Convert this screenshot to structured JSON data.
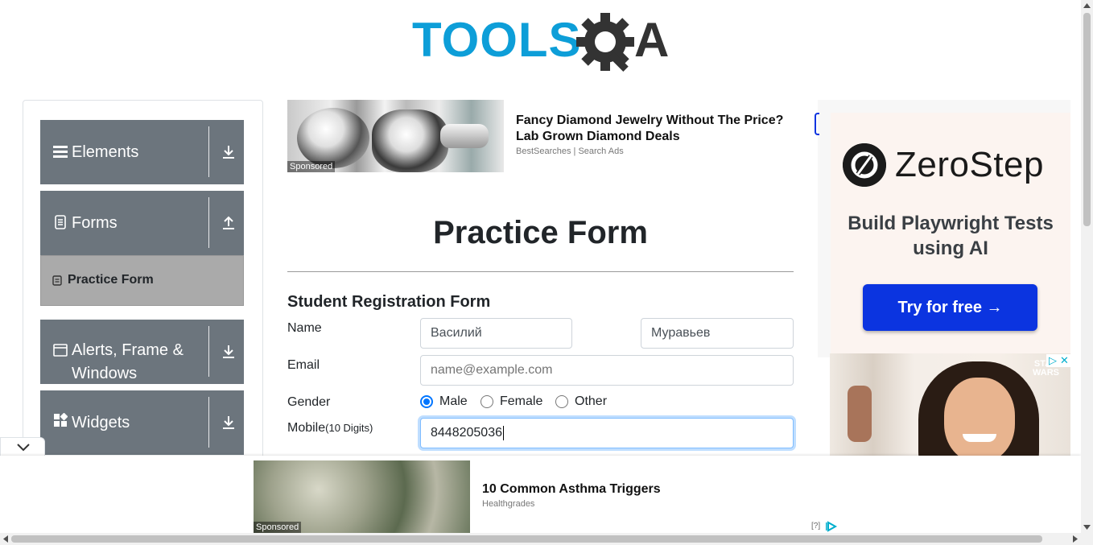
{
  "header": {
    "logo_text": "TOOLSQA"
  },
  "sidebar": {
    "groups": [
      {
        "label": "Elements"
      },
      {
        "label": "Forms"
      },
      {
        "label": "Alerts, Frame &"
      },
      {
        "label": "Windows"
      },
      {
        "label": "Widgets"
      }
    ],
    "active_item": "Practice Form"
  },
  "ad_top": {
    "headline": "Fancy Diamond Jewelry Without The Price? Lab Grown Diamond Deals",
    "source": "BestSearches | Search Ads",
    "sponsored": "Sponsored"
  },
  "main": {
    "page_title": "Practice Form",
    "form_title": "Student Registration Form",
    "name_label": "Name",
    "first_name": "Василий",
    "last_name": "Муравьев",
    "email_label": "Email",
    "email_placeholder": "name@example.com",
    "gender_label": "Gender",
    "gender_options": [
      {
        "label": "Male",
        "checked": true
      },
      {
        "label": "Female",
        "checked": false
      },
      {
        "label": "Other",
        "checked": false
      }
    ],
    "mobile_label": "Mobile",
    "mobile_hint": "(10 Digits)",
    "mobile_value": "8448205036"
  },
  "ad_right": {
    "brand": "ZeroStep",
    "tagline": "Build Playwright Tests using AI",
    "cta": "Try for free →",
    "star_wars": "STAR WARS",
    "close_info": "▷",
    "close_x": "✕"
  },
  "ad_bottom": {
    "headline": "10 Common Asthma Triggers",
    "source": "Healthgrades",
    "sponsored": "Sponsored",
    "choices": "[?]"
  },
  "colors": {
    "sidebar_group": "#6c757d",
    "sidebar_active": "#aaaaaa",
    "accent": "#0075ff",
    "zerostep_button": "#0b34e0",
    "logo_blue": "#0d9ed8",
    "logo_dark": "#333333"
  }
}
